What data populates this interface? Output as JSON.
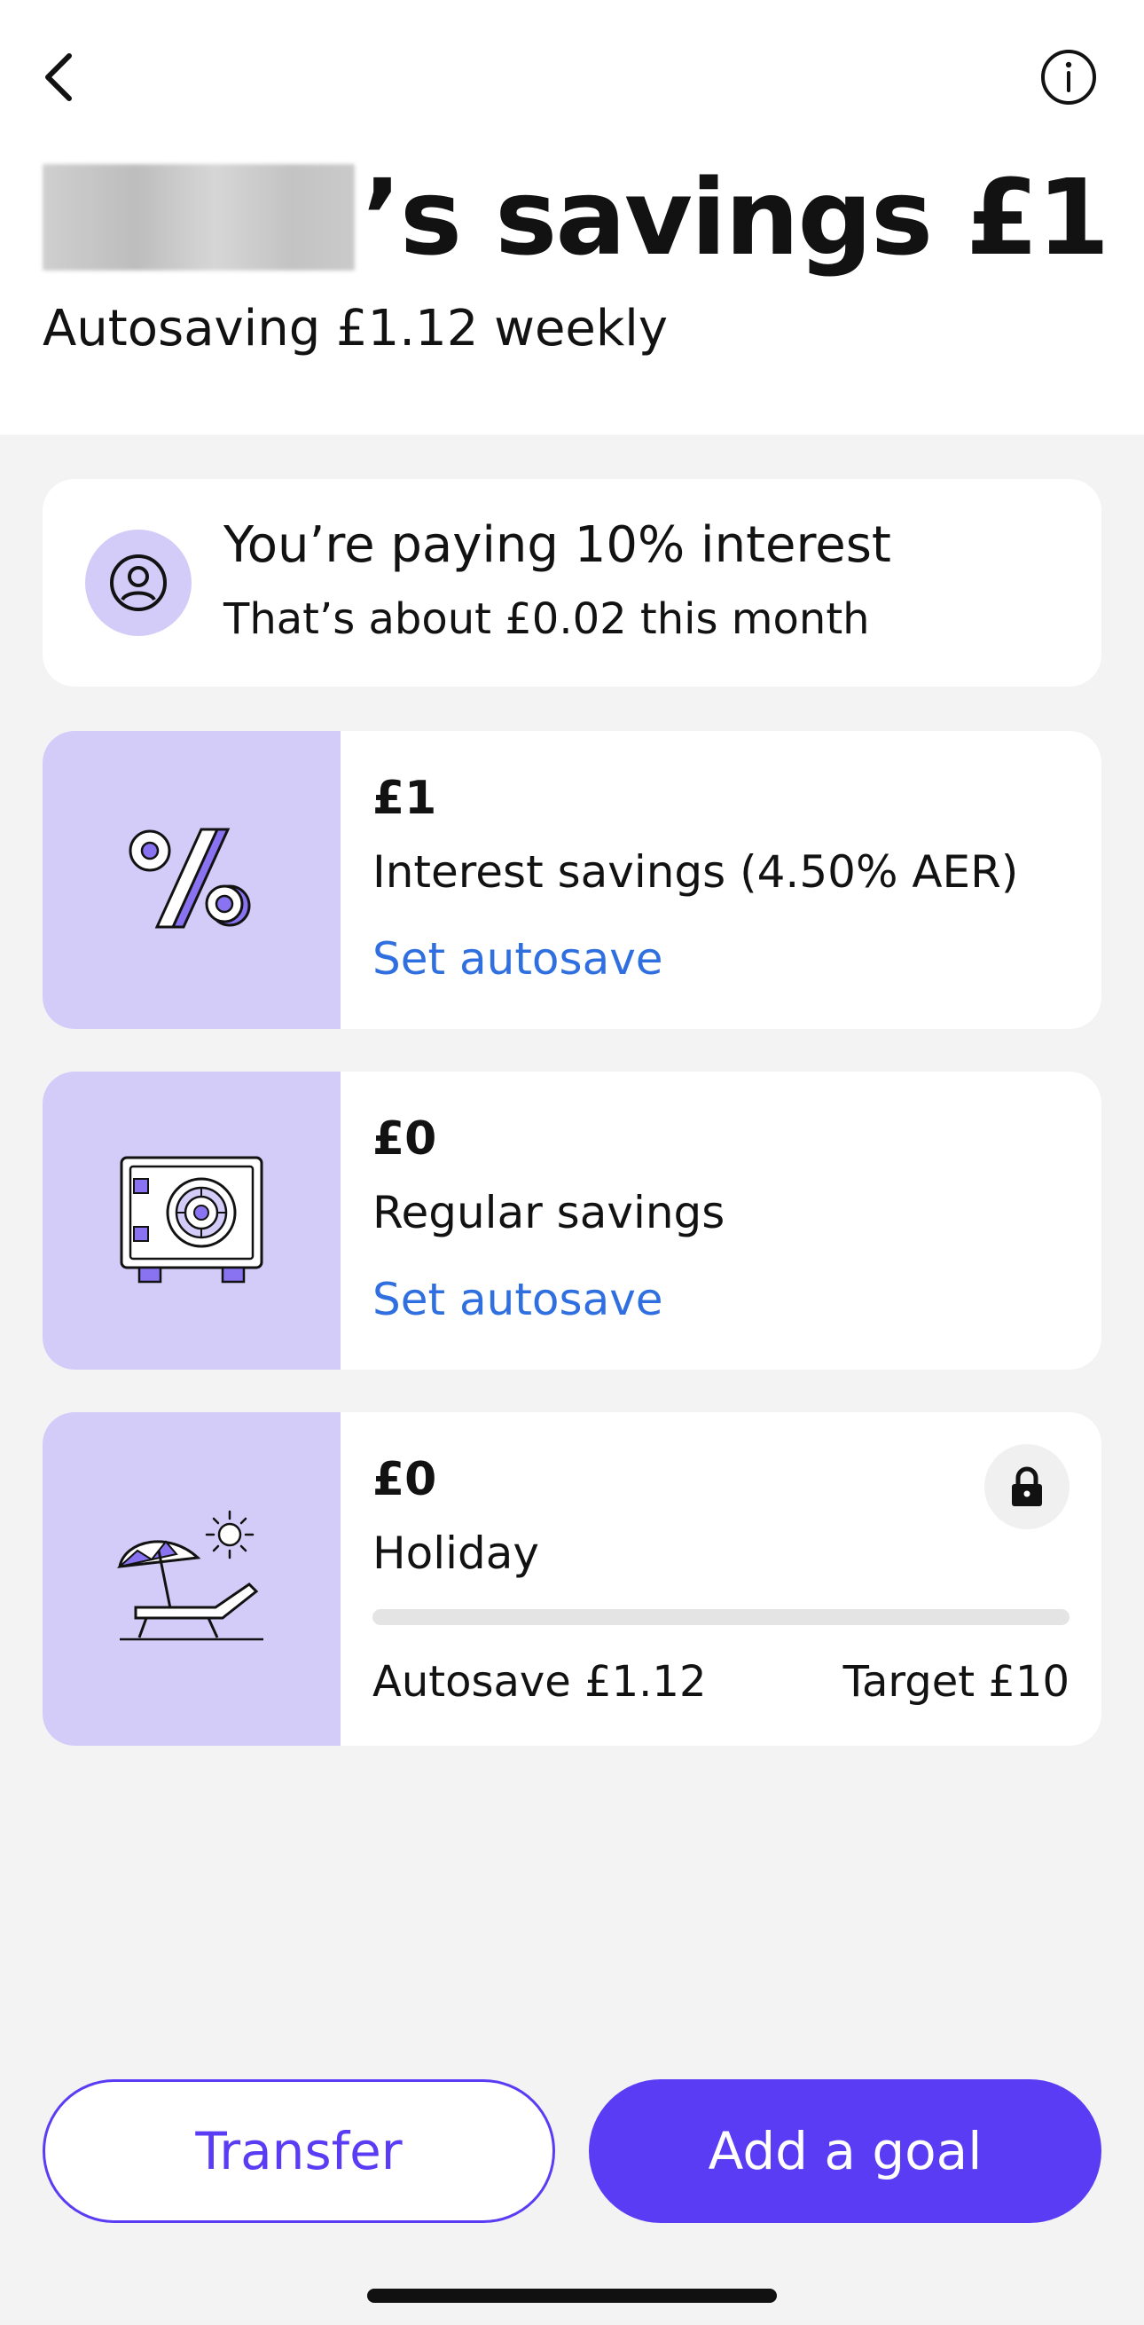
{
  "header": {
    "title_suffix": "’s savings £1",
    "subtitle": "Autosaving £1.12 weekly",
    "back_icon": "chevron-left-icon",
    "info_icon": "info-icon"
  },
  "interest_card": {
    "title": "You’re paying 10% interest",
    "subtitle": "That’s about £0.02 this month",
    "icon": "user-circle-icon"
  },
  "pots": [
    {
      "amount": "£1",
      "name": "Interest savings (4.50% AER)",
      "action": "Set autosave",
      "icon": "percent-icon"
    },
    {
      "amount": "£0",
      "name": "Regular savings",
      "action": "Set autosave",
      "icon": "safe-icon"
    },
    {
      "amount": "£0",
      "name": "Holiday",
      "autosave": "Autosave £1.12",
      "target": "Target £10",
      "progress": 0,
      "icon": "beach-icon",
      "lock_icon": "lock-icon"
    }
  ],
  "actions": {
    "transfer": "Transfer",
    "add_goal": "Add a goal"
  },
  "colors": {
    "accent": "#5b3cf5",
    "link": "#2f6fe0",
    "thumb_bg": "#d4ccf8",
    "page_bg": "#f3f3f4"
  }
}
